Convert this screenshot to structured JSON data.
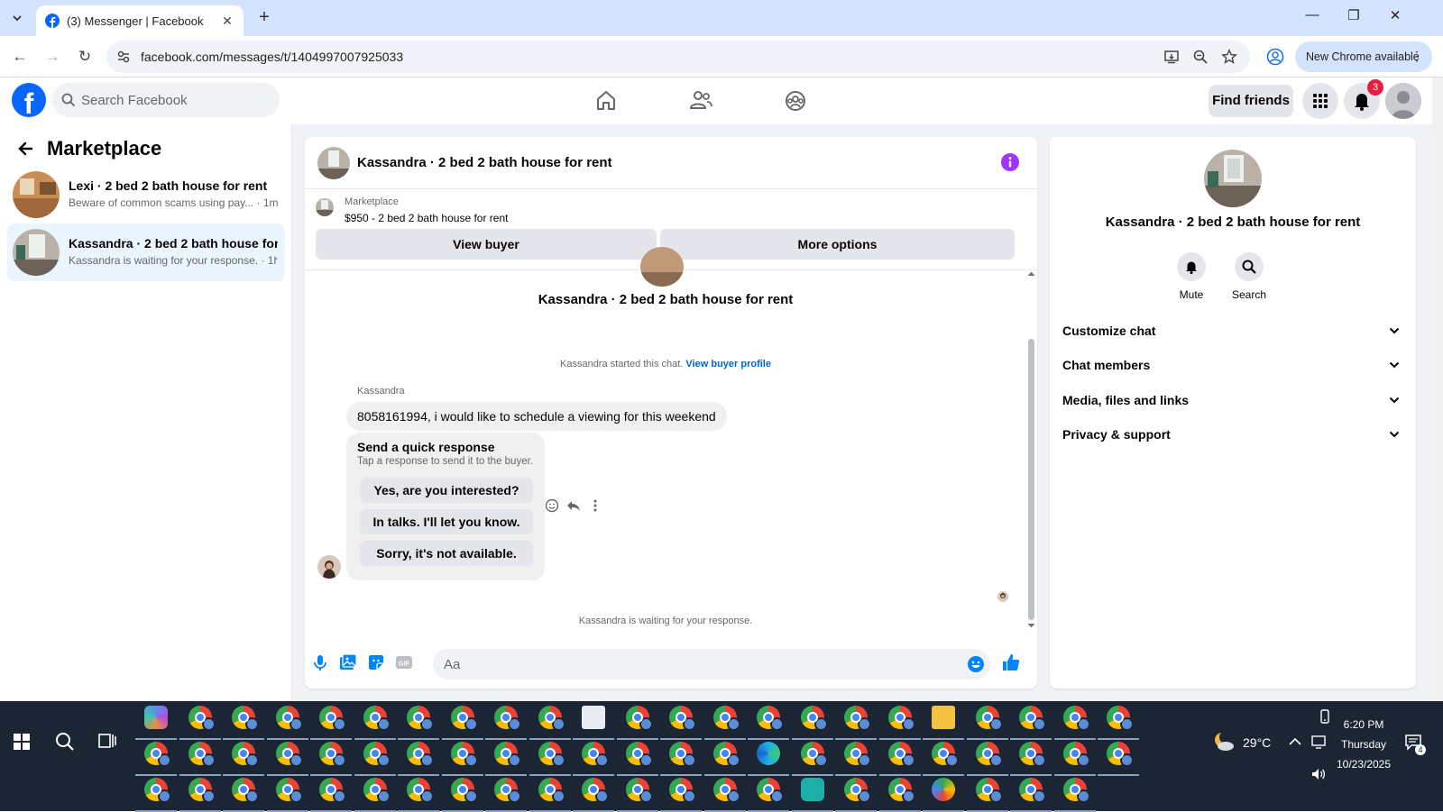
{
  "browser": {
    "tab_title": "(3) Messenger | Facebook",
    "url": "facebook.com/messages/t/1404997007925033",
    "new_chrome_label": "New Chrome available"
  },
  "fb": {
    "search_placeholder": "Search Facebook",
    "find_friends": "Find friends",
    "notification_count": "3"
  },
  "sidebar": {
    "title": "Marketplace",
    "conversations": [
      {
        "title": "Lexi · 2 bed 2 bath house for rent",
        "preview": "Beware of common scams using pay...",
        "time": " · 1m"
      },
      {
        "title": "Kassandra · 2 bed 2 bath house for...",
        "preview": "Kassandra is waiting for your response.",
        "time": " · 1h"
      }
    ]
  },
  "chat": {
    "title": "Kassandra · 2 bed 2 bath house for rent",
    "listing_label": "Marketplace",
    "listing_price": "$950 - 2 bed 2 bath house for rent",
    "view_buyer": "View buyer",
    "more_options": "More options",
    "body_title": "Kassandra · 2 bed 2 bath house for rent",
    "started_text": "Kassandra started this chat. ",
    "view_buyer_profile": "View buyer profile",
    "sender": "Kassandra",
    "message": "8058161994, i would like to schedule a viewing for this weekend",
    "quick_title": "Send a quick response",
    "quick_sub": "Tap a response to send it to the buyer.",
    "quick_options": [
      "Yes, are you interested?",
      "In talks. I'll let you know.",
      "Sorry, it's not available."
    ],
    "waiting": "Kassandra is waiting for your response.",
    "composer_placeholder": "Aa"
  },
  "details": {
    "title": "Kassandra · 2 bed 2 bath house for rent",
    "mute": "Mute",
    "search": "Search",
    "sections": [
      "Customize chat",
      "Chat members",
      "Media, files and links",
      "Privacy & support"
    ]
  },
  "taskbar": {
    "temperature": "29°C",
    "time": "6:20 PM",
    "day": "Thursday",
    "date": "10/23/2025",
    "notification_count": "4"
  },
  "colors": {
    "fb_blue": "#0866ff",
    "messenger_accent": "#0084ff",
    "info_purple": "#a033ff",
    "badge_red": "#e41e3f"
  }
}
